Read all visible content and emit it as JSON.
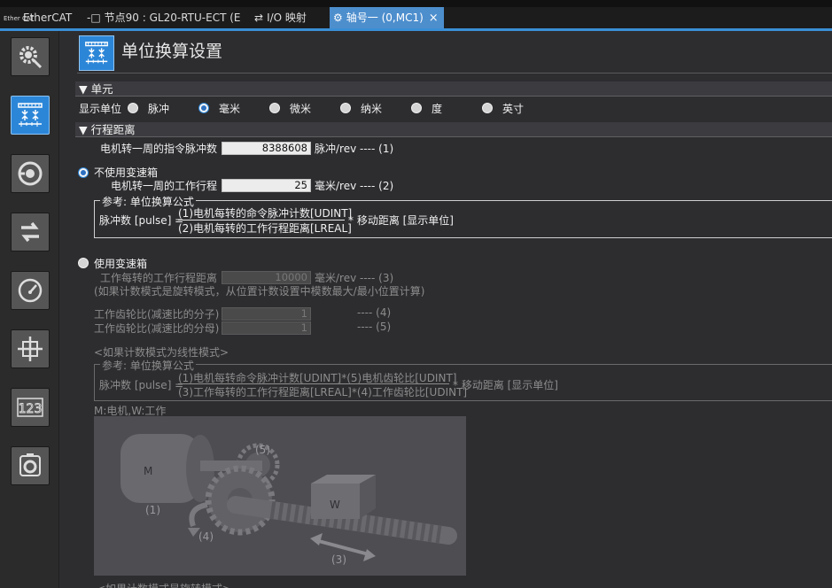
{
  "tabs": [
    {
      "icon_text": "Ether CAT",
      "label": "EtherCAT"
    },
    {
      "icon_text": "-□",
      "label": "节点90 : GL20-RTU-ECT (E..."
    },
    {
      "icon_text": "⇄",
      "label": "I/O 映射"
    },
    {
      "icon_text": "⚙",
      "label": "轴号一 (0,MC1)",
      "close": "×"
    }
  ],
  "sidebar": [
    "axis-settings-icon",
    "unit-conversion-icon",
    "operation-icon",
    "other-settings-icon",
    "speed-meter-icon",
    "position-limit-icon",
    "count-mode-icon",
    "servo-icon"
  ],
  "header": {
    "title": "单位换算设置"
  },
  "unit_section": {
    "title": "▼ 单元",
    "display_label": "显示单位",
    "options": [
      "脉冲",
      "毫米",
      "微米",
      "纳米",
      "度",
      "英寸"
    ],
    "selected": "毫米"
  },
  "travel_section": {
    "title": "▼ 行程距离",
    "pulses_label": "电机转一周的指令脉冲数",
    "pulses_value": "8388608",
    "pulses_unit": "脉冲/rev ---- (1)",
    "no_gear": {
      "label": "不使用变速箱",
      "travel_label": "电机转一周的工作行程",
      "travel_value": "25",
      "travel_unit": "毫米/rev ---- (2)",
      "formula_legend": "参考: 单位换算公式",
      "formula_lhs": "脉冲数 [pulse] =",
      "numerator": "(1)电机每转的命令脉冲计数[UDINT]",
      "denominator": "(2)电机每转的工作行程距离[LREAL]",
      "rhs": "* 移动距离 [显示单位]"
    },
    "with_gear": {
      "label": "使用变速箱",
      "work_label": "工作每转的工作行程距离",
      "work_value": "10000",
      "work_unit": "毫米/rev ---- (3)",
      "work_note": "(如果计数模式是旋转模式，从位置计数设置中模数最大/最小位置计算)",
      "gear_num_label": "工作齿轮比(减速比的分子)",
      "gear_num_value": "1",
      "gear_num_tag": "---- (4)",
      "gear_den_label": "工作齿轮比(减速比的分母)",
      "gear_den_value": "1",
      "gear_den_tag": "---- (5)",
      "linear_note": "<如果计数模式为线性模式>",
      "formula_legend": "参考: 单位换算公式",
      "formula_lhs": "脉冲数 [pulse] =",
      "numerator": "(1)电机每转命令脉冲计数[UDINT]*(5)电机齿轮比[UDINT]",
      "denominator": "(3)工作每转的工作行程距离[LREAL]*(4)工作齿轮比[UDINT]",
      "rhs": "* 移动距离 [显示单位]",
      "diagram_caption": "M:电机,W:工作",
      "diagram_labels": {
        "motor": "M",
        "work": "W",
        "n1": "(1)",
        "n3": "(3)",
        "n4": "(4)",
        "n5": "(5)"
      },
      "bottom_note": "<如果计数模式是旋转模式>"
    }
  }
}
